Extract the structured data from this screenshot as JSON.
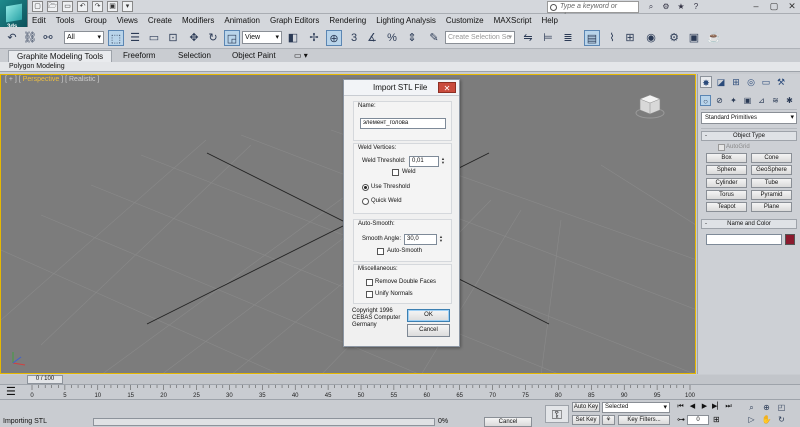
{
  "logo": {
    "text": "3ds"
  },
  "quick_access": [
    "▢",
    "🗁",
    "▭",
    "↶",
    "↷",
    "▣",
    "▾"
  ],
  "search": {
    "placeholder": "Type a keyword or phrase"
  },
  "title_icons": [
    "⌕",
    "⚙",
    "★",
    "?"
  ],
  "window_buttons": [
    "–",
    "▢",
    "✕"
  ],
  "menu": [
    "Edit",
    "Tools",
    "Group",
    "Views",
    "Create",
    "Modifiers",
    "Animation",
    "Graph Editors",
    "Rendering",
    "Lighting Analysis",
    "Customize",
    "MAXScript",
    "Help"
  ],
  "toolbar": {
    "filter": "All",
    "ref_coord": "View",
    "selection_set": "Create Selection Se"
  },
  "ribbon": {
    "tabs": [
      "Graphite Modeling Tools",
      "Freeform",
      "Selection",
      "Object Paint"
    ],
    "panel_label": "Polygon Modeling"
  },
  "viewport": {
    "label_open": "[ + ] [ ",
    "label_view": "Perspective",
    "label_close": " ] [ Realistic ]"
  },
  "dialog": {
    "title": "Import STL File",
    "close": "✕",
    "name_group": "Name:",
    "name_value": "элемент_голова",
    "weld_group": "Weld Vertices:",
    "weld_threshold_label": "Weld Threshold:",
    "weld_threshold_value": "0,01",
    "weld_label": "Weld",
    "use_threshold_label": "Use Threshold",
    "quick_weld_label": "Quick Weld",
    "autosmooth_group": "Auto-Smooth:",
    "smooth_angle_label": "Smooth Angle:",
    "smooth_angle_value": "30,0",
    "autosmooth_label": "Auto-Smooth",
    "misc_group": "Miscellaneous:",
    "remove_double_label": "Remove Double Faces",
    "unify_normals_label": "Unify Normals",
    "copyright": "Copyright 1996 CEBAS Computer Germany",
    "ok": "OK",
    "cancel": "Cancel"
  },
  "command_panel": {
    "dropdown": "Standard Primitives",
    "object_type": "Object Type",
    "autogrid": "AutoGrid",
    "primitives": [
      "Box",
      "Cone",
      "Sphere",
      "GeoSphere",
      "Cylinder",
      "Tube",
      "Torus",
      "Pyramid",
      "Teapot",
      "Plane"
    ],
    "name_and_color": "Name and Color",
    "object_color": "#8b1a2e"
  },
  "timeline": {
    "slider": "0 / 100",
    "ticks": [
      "0",
      "5",
      "10",
      "15",
      "20",
      "25",
      "30",
      "35",
      "40",
      "45",
      "50",
      "55",
      "60",
      "65",
      "70",
      "75",
      "80",
      "85",
      "90",
      "95",
      "100"
    ]
  },
  "status": {
    "text": "Importing STL",
    "progress_pct": "0%",
    "progress_value": 0,
    "cancel": "Cancel",
    "auto_key": "Auto Key",
    "set_key": "Set Key",
    "selected": "Selected",
    "key_filters": "Key Filters...",
    "frame": "0"
  },
  "colors": {
    "viewport_bg": "#7c7c7c",
    "active_viewport_border": "#e6b800",
    "close_button": "#c94b3d"
  }
}
